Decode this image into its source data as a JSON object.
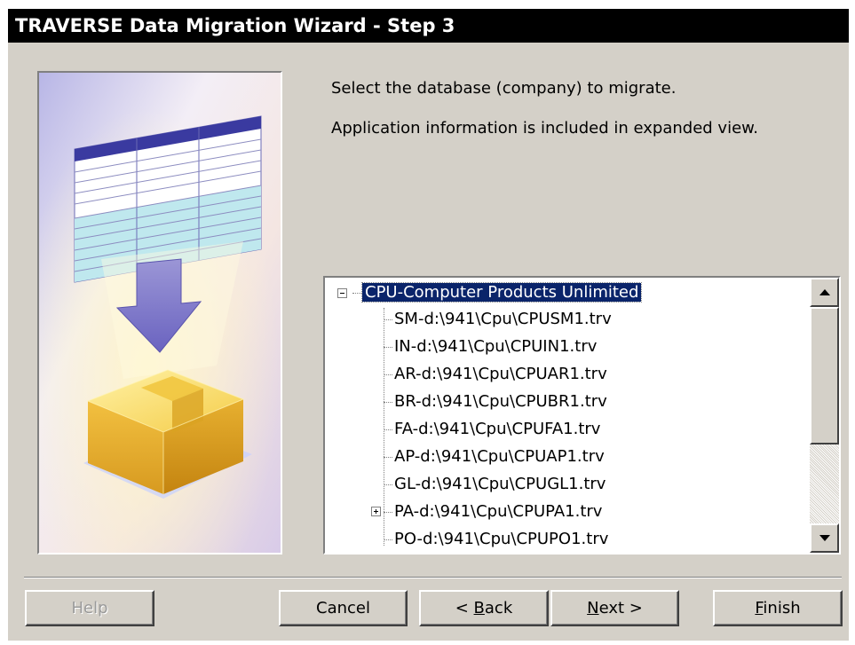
{
  "window": {
    "title": "TRAVERSE Data Migration Wizard - Step 3"
  },
  "instructions": {
    "line1": "Select the database (company) to migrate.",
    "line2": "Application information is included in expanded view."
  },
  "tree": {
    "root_label": "CPU-Computer Products Unlimited",
    "items": [
      {
        "label": "SM-d:\\941\\Cpu\\CPUSM1.trv"
      },
      {
        "label": "IN-d:\\941\\Cpu\\CPUIN1.trv"
      },
      {
        "label": "AR-d:\\941\\Cpu\\CPUAR1.trv"
      },
      {
        "label": "BR-d:\\941\\Cpu\\CPUBR1.trv"
      },
      {
        "label": "FA-d:\\941\\Cpu\\CPUFA1.trv"
      },
      {
        "label": "AP-d:\\941\\Cpu\\CPUAP1.trv"
      },
      {
        "label": "GL-d:\\941\\Cpu\\CPUGL1.trv"
      },
      {
        "label": "PA-d:\\941\\Cpu\\CPUPA1.trv"
      },
      {
        "label": "PO-d:\\941\\Cpu\\CPUPO1.trv"
      }
    ]
  },
  "buttons": {
    "help": "Help",
    "cancel": "Cancel",
    "back": {
      "prefix": "< ",
      "mnemonic": "B",
      "rest": "ack"
    },
    "next": {
      "mnemonic": "N",
      "rest": "ext >"
    },
    "finish": {
      "mnemonic": "F",
      "rest": "inish"
    }
  }
}
